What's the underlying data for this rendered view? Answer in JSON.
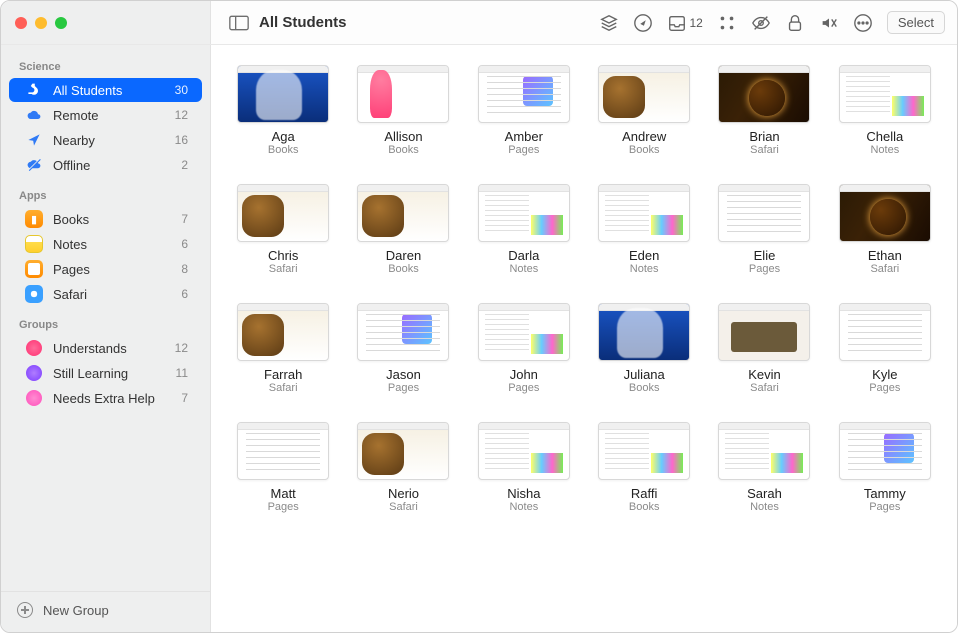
{
  "window": {
    "title": "All Students",
    "inbox_count": "12",
    "select_label": "Select"
  },
  "sidebar": {
    "sections": [
      {
        "header": "Science",
        "items": [
          {
            "icon": "microscope-icon",
            "label": "All Students",
            "count": "30",
            "selected": true
          },
          {
            "icon": "cloud-icon",
            "label": "Remote",
            "count": "12",
            "selected": false
          },
          {
            "icon": "location-icon",
            "label": "Nearby",
            "count": "16",
            "selected": false
          },
          {
            "icon": "offline-icon",
            "label": "Offline",
            "count": "2",
            "selected": false
          }
        ]
      },
      {
        "header": "Apps",
        "items": [
          {
            "icon": "books-app-icon",
            "label": "Books",
            "count": "7",
            "selected": false
          },
          {
            "icon": "notes-app-icon",
            "label": "Notes",
            "count": "6",
            "selected": false
          },
          {
            "icon": "pages-app-icon",
            "label": "Pages",
            "count": "8",
            "selected": false
          },
          {
            "icon": "safari-app-icon",
            "label": "Safari",
            "count": "6",
            "selected": false
          }
        ]
      },
      {
        "header": "Groups",
        "items": [
          {
            "icon": "group-red-icon",
            "label": "Understands",
            "count": "12",
            "selected": false
          },
          {
            "icon": "group-purple-icon",
            "label": "Still Learning",
            "count": "11",
            "selected": false
          },
          {
            "icon": "group-pink-icon",
            "label": "Needs Extra Help",
            "count": "7",
            "selected": false
          }
        ]
      }
    ],
    "footer": {
      "label": "New Group"
    }
  },
  "students": [
    {
      "name": "Aga",
      "app": "Books",
      "thumb": "blue"
    },
    {
      "name": "Allison",
      "app": "Books",
      "thumb": "flam"
    },
    {
      "name": "Amber",
      "app": "Pages",
      "thumb": "doc-color"
    },
    {
      "name": "Andrew",
      "app": "Books",
      "thumb": "mammoth"
    },
    {
      "name": "Brian",
      "app": "Safari",
      "thumb": "space"
    },
    {
      "name": "Chella",
      "app": "Notes",
      "thumb": "notes"
    },
    {
      "name": "Chris",
      "app": "Safari",
      "thumb": "mammoth"
    },
    {
      "name": "Daren",
      "app": "Books",
      "thumb": "mammoth"
    },
    {
      "name": "Darla",
      "app": "Notes",
      "thumb": "notes"
    },
    {
      "name": "Eden",
      "app": "Notes",
      "thumb": "notes"
    },
    {
      "name": "Elie",
      "app": "Pages",
      "thumb": "doc"
    },
    {
      "name": "Ethan",
      "app": "Safari",
      "thumb": "space"
    },
    {
      "name": "Farrah",
      "app": "Safari",
      "thumb": "mammoth"
    },
    {
      "name": "Jason",
      "app": "Pages",
      "thumb": "doc-color"
    },
    {
      "name": "John",
      "app": "Pages",
      "thumb": "notes"
    },
    {
      "name": "Juliana",
      "app": "Books",
      "thumb": "blue"
    },
    {
      "name": "Kevin",
      "app": "Safari",
      "thumb": "shakes"
    },
    {
      "name": "Kyle",
      "app": "Pages",
      "thumb": "doc"
    },
    {
      "name": "Matt",
      "app": "Pages",
      "thumb": "doc"
    },
    {
      "name": "Nerio",
      "app": "Safari",
      "thumb": "mammoth"
    },
    {
      "name": "Nisha",
      "app": "Notes",
      "thumb": "notes"
    },
    {
      "name": "Raffi",
      "app": "Books",
      "thumb": "notes"
    },
    {
      "name": "Sarah",
      "app": "Notes",
      "thumb": "notes"
    },
    {
      "name": "Tammy",
      "app": "Pages",
      "thumb": "doc-color"
    }
  ]
}
